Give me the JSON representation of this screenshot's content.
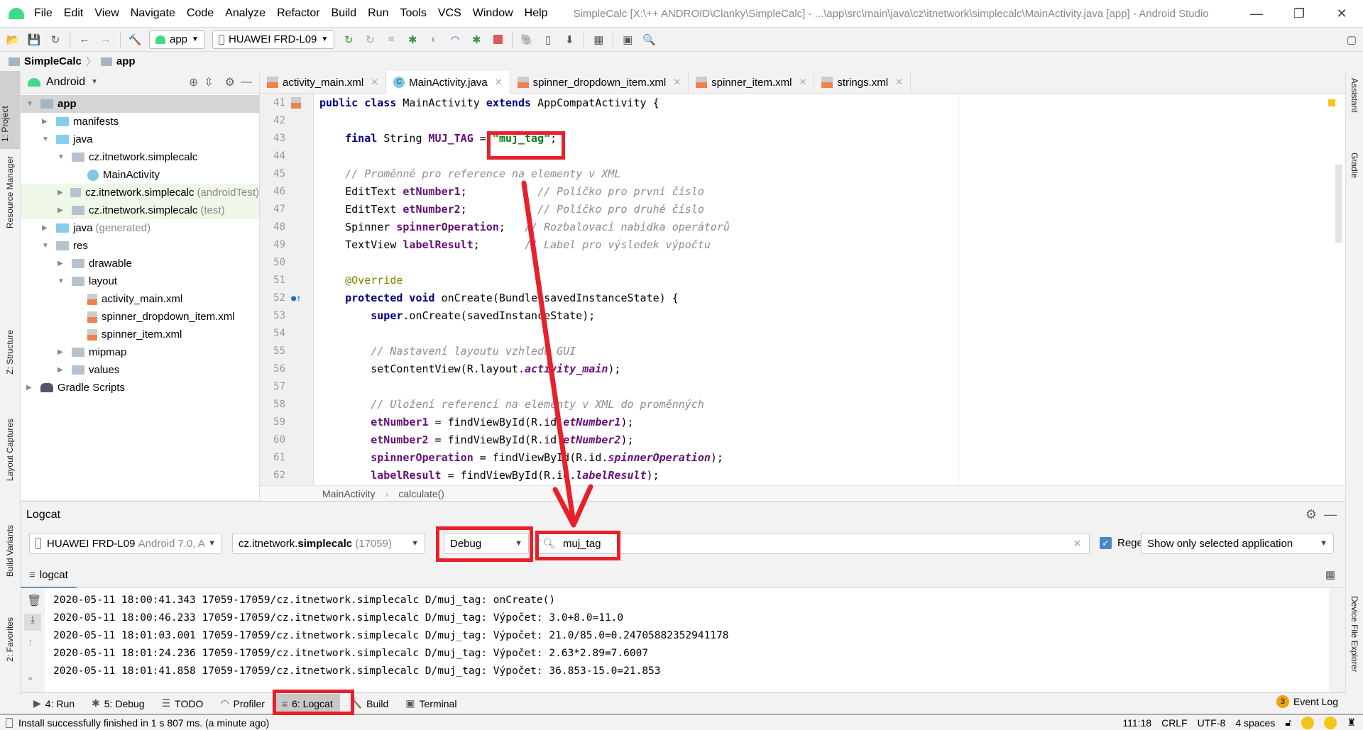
{
  "menu": {
    "items": [
      "File",
      "Edit",
      "View",
      "Navigate",
      "Code",
      "Analyze",
      "Refactor",
      "Build",
      "Run",
      "Tools",
      "VCS",
      "Window",
      "Help"
    ],
    "window_title": "SimpleCalc [X:\\++ ANDROID\\Clanky\\SimpleCalc] - ...\\app\\src\\main\\java\\cz\\itnetwork\\simplecalc\\MainActivity.java [app] - Android Studio"
  },
  "toolbar": {
    "run_config": "app",
    "device": "HUAWEI FRD-L09"
  },
  "breadcrumb": {
    "project": "SimpleCalc",
    "module": "app"
  },
  "left_stripe": {
    "project": "1: Project",
    "resource_manager": "Resource Manager",
    "structure": "Z: Structure",
    "layout_captures": "Layout Captures",
    "build_variants": "Build Variants",
    "favorites": "2: Favorites"
  },
  "right_stripe": {
    "assistant": "Assistant",
    "gradle": "Gradle",
    "device_file_explorer": "Device File Explorer"
  },
  "project": {
    "view": "Android",
    "tree": [
      {
        "label": "app",
        "depth": 0,
        "open": true,
        "bold": true,
        "icon": "module"
      },
      {
        "label": "manifests",
        "depth": 1,
        "open": false,
        "icon": "folder-blue"
      },
      {
        "label": "java",
        "depth": 1,
        "open": true,
        "icon": "folder-blue"
      },
      {
        "label": "cz.itnetwork.simplecalc",
        "depth": 2,
        "open": true,
        "icon": "package"
      },
      {
        "label": "MainActivity",
        "depth": 3,
        "icon": "class"
      },
      {
        "label": "cz.itnetwork.simplecalc",
        "suffix": "(androidTest)",
        "depth": 2,
        "open": false,
        "icon": "package",
        "hl": true
      },
      {
        "label": "cz.itnetwork.simplecalc",
        "suffix": "(test)",
        "depth": 2,
        "open": false,
        "icon": "package",
        "hl": true
      },
      {
        "label": "java",
        "suffix": "(generated)",
        "depth": 1,
        "open": false,
        "icon": "folder-gen"
      },
      {
        "label": "res",
        "depth": 1,
        "open": true,
        "icon": "res"
      },
      {
        "label": "drawable",
        "depth": 2,
        "open": false,
        "icon": "package"
      },
      {
        "label": "layout",
        "depth": 2,
        "open": true,
        "icon": "package"
      },
      {
        "label": "activity_main.xml",
        "depth": 3,
        "icon": "xml"
      },
      {
        "label": "spinner_dropdown_item.xml",
        "depth": 3,
        "icon": "xml"
      },
      {
        "label": "spinner_item.xml",
        "depth": 3,
        "icon": "xml"
      },
      {
        "label": "mipmap",
        "depth": 2,
        "open": false,
        "icon": "package"
      },
      {
        "label": "values",
        "depth": 2,
        "open": false,
        "icon": "package"
      },
      {
        "label": "Gradle Scripts",
        "depth": 0,
        "open": false,
        "icon": "gradle"
      }
    ]
  },
  "editor_tabs": [
    {
      "label": "activity_main.xml",
      "icon": "xml"
    },
    {
      "label": "MainActivity.java",
      "icon": "class",
      "active": true
    },
    {
      "label": "spinner_dropdown_item.xml",
      "icon": "xml"
    },
    {
      "label": "spinner_item.xml",
      "icon": "xml"
    },
    {
      "label": "strings.xml",
      "icon": "xml"
    }
  ],
  "code": [
    {
      "n": "41",
      "t": [
        [
          "public class ",
          "kw"
        ],
        [
          "MainActivity ",
          ""
        ],
        [
          "extends ",
          "kw"
        ],
        [
          "AppCompatActivity {",
          ""
        ]
      ]
    },
    {
      "n": "42",
      "t": []
    },
    {
      "n": "43",
      "t": [
        [
          "    final ",
          "kw"
        ],
        [
          "String ",
          ""
        ],
        [
          "MUJ_TAG",
          "fld"
        ],
        [
          " = ",
          ""
        ],
        [
          "\"muj_tag\"",
          "str"
        ],
        [
          ";",
          ""
        ]
      ]
    },
    {
      "n": "44",
      "t": []
    },
    {
      "n": "45",
      "t": [
        [
          "    // Proměnné pro reference na elementy v XML",
          "cmt"
        ]
      ]
    },
    {
      "n": "46",
      "t": [
        [
          "    EditText ",
          ""
        ],
        [
          "etNumber1",
          "fld"
        ],
        [
          ";           ",
          ""
        ],
        [
          "// Políčko pro první číslo",
          "cmt"
        ]
      ]
    },
    {
      "n": "47",
      "t": [
        [
          "    EditText ",
          ""
        ],
        [
          "etNumber2",
          "fld"
        ],
        [
          ";           ",
          ""
        ],
        [
          "// Políčko pro druhé číslo",
          "cmt"
        ]
      ]
    },
    {
      "n": "48",
      "t": [
        [
          "    Spinner ",
          ""
        ],
        [
          "spinnerOperation",
          "fld"
        ],
        [
          ";   ",
          ""
        ],
        [
          "// Rozbalovací nabídka operátorů",
          "cmt"
        ]
      ]
    },
    {
      "n": "49",
      "t": [
        [
          "    TextView ",
          ""
        ],
        [
          "labelResult",
          "fld"
        ],
        [
          ";       ",
          ""
        ],
        [
          "// Label pro výsledek výpočtu",
          "cmt"
        ]
      ]
    },
    {
      "n": "50",
      "t": []
    },
    {
      "n": "51",
      "t": [
        [
          "    @Override",
          "ann"
        ]
      ]
    },
    {
      "n": "52",
      "t": [
        [
          "    protected void ",
          "kw"
        ],
        [
          "onCreate(Bundle savedInstanceState) {",
          ""
        ]
      ]
    },
    {
      "n": "53",
      "t": [
        [
          "        super",
          "kw"
        ],
        [
          ".onCreate(savedInstanceState);",
          ""
        ]
      ]
    },
    {
      "n": "54",
      "t": []
    },
    {
      "n": "55",
      "t": [
        [
          "        // Nastavení layoutu vzhledu GUI",
          "cmt"
        ]
      ]
    },
    {
      "n": "56",
      "t": [
        [
          "        setContentView(R.layout.",
          ""
        ],
        [
          "activity_main",
          "ital"
        ],
        [
          ");",
          ""
        ]
      ]
    },
    {
      "n": "57",
      "t": []
    },
    {
      "n": "58",
      "t": [
        [
          "        // Uložení referencí na elementy v XML do proměnných",
          "cmt"
        ]
      ]
    },
    {
      "n": "59",
      "t": [
        [
          "        etNumber1",
          "fld"
        ],
        [
          " = findViewById(R.id.",
          ""
        ],
        [
          "etNumber1",
          "ital"
        ],
        [
          ");",
          ""
        ]
      ]
    },
    {
      "n": "60",
      "t": [
        [
          "        etNumber2",
          "fld"
        ],
        [
          " = findViewById(R.id.",
          ""
        ],
        [
          "etNumber2",
          "ital"
        ],
        [
          ");",
          ""
        ]
      ]
    },
    {
      "n": "61",
      "t": [
        [
          "        spinnerOperation",
          "fld"
        ],
        [
          " = findViewById(R.id.",
          ""
        ],
        [
          "spinnerOperation",
          "ital"
        ],
        [
          ");",
          ""
        ]
      ]
    },
    {
      "n": "62",
      "t": [
        [
          "        labelResult",
          "fld"
        ],
        [
          " = findViewById(R.id.",
          ""
        ],
        [
          "labelResult",
          "ital"
        ],
        [
          ");",
          ""
        ]
      ]
    }
  ],
  "editor_breadcrumb": [
    "MainActivity",
    "calculate()"
  ],
  "logcat": {
    "title": "Logcat",
    "device": "HUAWEI FRD-L09",
    "device_suffix": "Android 7.0, A",
    "process_pre": "cz.itnetwork.",
    "process_bold": "simplecalc",
    "process_pid": "(17059)",
    "level": "Debug",
    "search": "muj_tag",
    "regex_label": "Regex",
    "regex_checked": true,
    "filter": "Show only selected application",
    "tab": "logcat",
    "lines": [
      "2020-05-11 18:00:41.343 17059-17059/cz.itnetwork.simplecalc D/muj_tag: onCreate()",
      "2020-05-11 18:00:46.233 17059-17059/cz.itnetwork.simplecalc D/muj_tag: Výpočet: 3.0+8.0=11.0",
      "2020-05-11 18:01:03.001 17059-17059/cz.itnetwork.simplecalc D/muj_tag: Výpočet: 21.0/85.0=0.24705882352941178",
      "2020-05-11 18:01:24.236 17059-17059/cz.itnetwork.simplecalc D/muj_tag: Výpočet: 2.63*2.89=7.6007",
      "2020-05-11 18:01:41.858 17059-17059/cz.itnetwork.simplecalc D/muj_tag: Výpočet: 36.853-15.0=21.853"
    ]
  },
  "tool_windows": [
    {
      "label": "4: Run",
      "icon": "run-icon"
    },
    {
      "label": "5: Debug",
      "icon": "bug-icon"
    },
    {
      "label": "TODO",
      "icon": "list-icon"
    },
    {
      "label": "Profiler",
      "icon": "gauge-icon"
    },
    {
      "label": "6: Logcat",
      "icon": "logcat-icon",
      "selected": true
    },
    {
      "label": "Build",
      "icon": "hammer-icon"
    },
    {
      "label": "Terminal",
      "icon": "terminal-icon"
    }
  ],
  "event_log": {
    "label": "Event Log",
    "count": "3"
  },
  "status": {
    "message": "Install successfully finished in 1 s 807 ms. (a minute ago)",
    "position": "111:18",
    "line_sep": "CRLF",
    "encoding": "UTF-8",
    "indent": "4 spaces"
  },
  "colors": {
    "annotation_red": "#e8202a",
    "android_green": "#3ddc84",
    "keyword": "#000080",
    "string": "#067d17"
  }
}
